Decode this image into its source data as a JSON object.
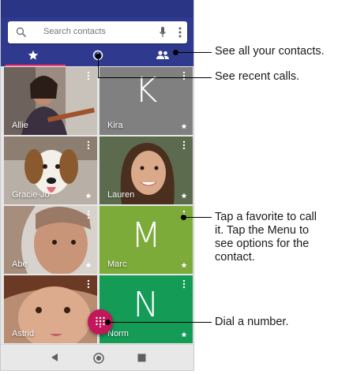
{
  "search": {
    "placeholder": "Search contacts"
  },
  "tabs": [
    {
      "name": "favorites",
      "icon": "star-icon"
    },
    {
      "name": "recents",
      "icon": "clock-icon"
    },
    {
      "name": "contacts",
      "icon": "people-icon"
    }
  ],
  "contacts": [
    {
      "name": "Allie",
      "type": "photo"
    },
    {
      "name": "Kira",
      "type": "letter",
      "letter": "K",
      "color": "#808080"
    },
    {
      "name": "Gracie-Jo",
      "type": "photo"
    },
    {
      "name": "Lauren",
      "type": "photo"
    },
    {
      "name": "Abe",
      "type": "photo"
    },
    {
      "name": "Marc",
      "type": "letter",
      "letter": "M",
      "color": "#7cab3a"
    },
    {
      "name": "Astrid",
      "type": "photo"
    },
    {
      "name": "Norm",
      "type": "letter",
      "letter": "N",
      "color": "#149c57"
    }
  ],
  "callouts": {
    "all_contacts": "See all your contacts.",
    "recent_calls": "See recent calls.",
    "favorite_line1": "Tap a favorite to call",
    "favorite_line2": "it. Tap the Menu to",
    "favorite_line3": "see options for the",
    "favorite_line4": "contact.",
    "dial": "Dial a number."
  },
  "colors": {
    "appbar": "#2f3a8f",
    "fab": "#c2185b",
    "tab_indicator": "#ff3d6e"
  }
}
